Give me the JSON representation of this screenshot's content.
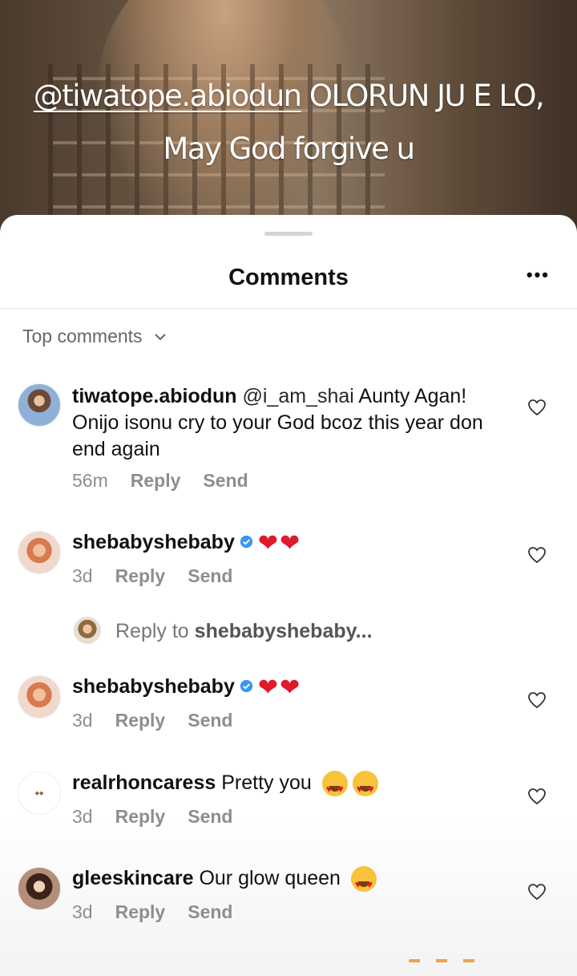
{
  "story": {
    "caption_mention": "@tiwatope.abiodun",
    "caption_line1_rest": " OLORUN JU E LO,",
    "caption_line2": "May God forgive u"
  },
  "sheet": {
    "title": "Comments",
    "more_icon": "ellipsis-icon",
    "filter_label": "Top comments"
  },
  "comments": [
    {
      "username": "tiwatope.abiodun",
      "mention": "@i_am_shai",
      "text": " Aunty Agan! Onijo isonu cry to your God bcoz this year don end again",
      "time": "56m",
      "reply": "Reply",
      "send": "Send"
    },
    {
      "username": "shebabyshebaby",
      "verified": true,
      "text": "❤❤",
      "time": "3d",
      "reply": "Reply",
      "send": "Send"
    },
    {
      "username": "shebabyshebaby",
      "verified": true,
      "text": "❤❤",
      "time": "3d",
      "reply": "Reply",
      "send": "Send"
    },
    {
      "username": "realrhoncaress",
      "text": "Pretty you",
      "time": "3d",
      "reply": "Reply",
      "send": "Send"
    },
    {
      "username": "gleeskincare",
      "text": "Our glow queen",
      "time": "3d",
      "reply": "Reply",
      "send": "Send"
    }
  ],
  "reply_prompt": {
    "prefix": "Reply to ",
    "target": "shebabyshebaby..."
  },
  "colors": {
    "heart": "#e0192b",
    "verified": "#3897f0",
    "meta": "#8e8e8e"
  }
}
